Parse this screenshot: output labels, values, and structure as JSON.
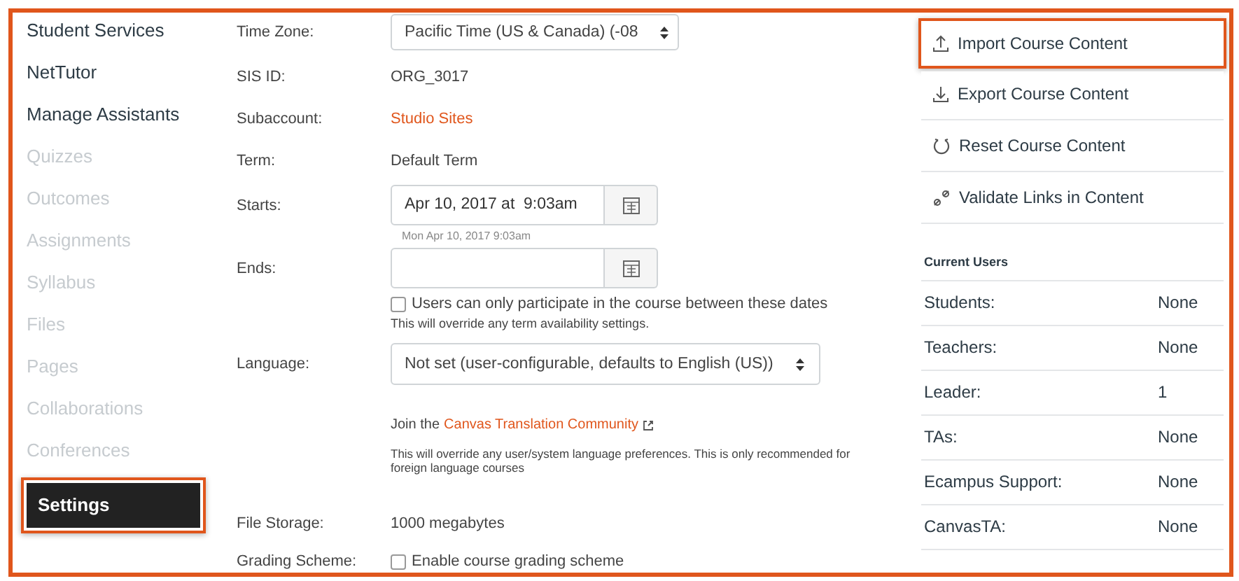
{
  "sidebar": {
    "items": [
      {
        "label": "Student Services",
        "disabled": false,
        "selected": false,
        "highlighted": false
      },
      {
        "label": "NetTutor",
        "disabled": false,
        "selected": false,
        "highlighted": false
      },
      {
        "label": "Manage Assistants",
        "disabled": false,
        "selected": false,
        "highlighted": false
      },
      {
        "label": "Quizzes",
        "disabled": true,
        "selected": false,
        "highlighted": false
      },
      {
        "label": "Outcomes",
        "disabled": true,
        "selected": false,
        "highlighted": false
      },
      {
        "label": "Assignments",
        "disabled": true,
        "selected": false,
        "highlighted": false
      },
      {
        "label": "Syllabus",
        "disabled": true,
        "selected": false,
        "highlighted": false
      },
      {
        "label": "Files",
        "disabled": true,
        "selected": false,
        "highlighted": false
      },
      {
        "label": "Pages",
        "disabled": true,
        "selected": false,
        "highlighted": false
      },
      {
        "label": "Collaborations",
        "disabled": true,
        "selected": false,
        "highlighted": false
      },
      {
        "label": "Conferences",
        "disabled": true,
        "selected": false,
        "highlighted": false
      },
      {
        "label": "Settings",
        "disabled": false,
        "selected": true,
        "highlighted": true
      }
    ]
  },
  "form": {
    "rows": [
      {
        "kind": "select",
        "label": "Time Zone:",
        "value": "Pacific Time (US & Canada) (-08"
      },
      {
        "kind": "text",
        "label": "SIS ID:",
        "value": "ORG_3017"
      },
      {
        "kind": "link",
        "label": "Subaccount:",
        "value": "Studio Sites"
      },
      {
        "kind": "text",
        "label": "Term:",
        "value": "Default Term"
      },
      {
        "kind": "date",
        "label": "Starts:",
        "value": "Apr 10, 2017 at  9:03am",
        "hint": "Mon Apr 10, 2017 9:03am"
      },
      {
        "kind": "date",
        "label": "Ends:"
      },
      {
        "kind": "checkbox",
        "text": "Users can only participate in the course between these dates",
        "checked": false,
        "note": "This will override any term availability settings."
      },
      {
        "kind": "wide_select",
        "label": "Language:",
        "value": "Not set (user-configurable, defaults to English (US))"
      },
      {
        "kind": "join",
        "text": "Join the",
        "link": "Canvas Translation Community",
        "note": "This will override any user/system language preferences. This is only recommended for foreign language courses"
      },
      {
        "kind": "text",
        "label": "File Storage:",
        "value": "1000 megabytes"
      },
      {
        "kind": "checkbox",
        "label": "Grading Scheme:",
        "text": "Enable course grading scheme",
        "checked": false
      }
    ]
  },
  "actions": [
    {
      "label": "Import Course Content",
      "kind": "import",
      "highlighted": true
    },
    {
      "label": "Export Course Content",
      "kind": "export",
      "highlighted": false
    },
    {
      "label": "Reset Course Content",
      "kind": "reset",
      "highlighted": false
    },
    {
      "label": "Validate Links in Content",
      "kind": "validate",
      "highlighted": false
    }
  ],
  "current_users": {
    "title": "Current Users",
    "rows": [
      {
        "role": "Students:",
        "count": "None"
      },
      {
        "role": "Teachers:",
        "count": "None"
      },
      {
        "role": "Leader:",
        "count": "1"
      },
      {
        "role": "TAs:",
        "count": "None"
      },
      {
        "role": "Ecampus Support:",
        "count": "None"
      },
      {
        "role": "CanvasTA:",
        "count": "None"
      }
    ]
  }
}
